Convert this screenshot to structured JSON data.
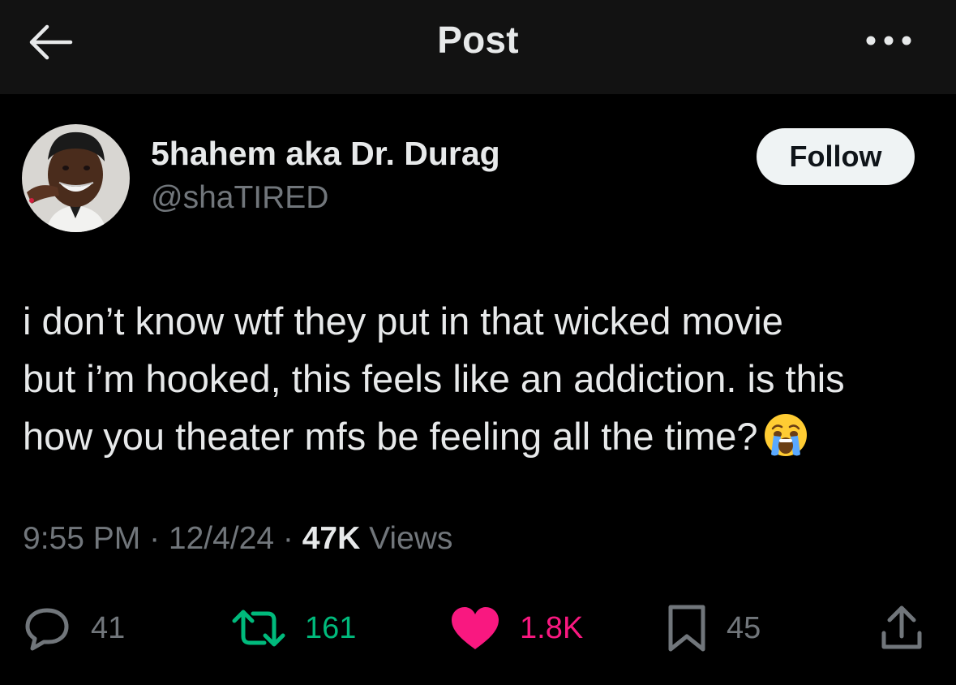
{
  "header": {
    "title": "Post"
  },
  "author": {
    "display_name": "5hahem aka Dr. Durag",
    "handle": "@shaTIRED",
    "follow_label": "Follow"
  },
  "post": {
    "lines": [
      "i don’t know wtf they put in that wicked movie",
      "but i’m hooked, this feels like an addiction. is this",
      "how you theater mfs be feeling all the time?"
    ],
    "emoji": "crying-face-emoji"
  },
  "meta": {
    "time": "9:55 PM",
    "sep1": " · ",
    "date": "12/4/24",
    "sep2": " · ",
    "views_count": "47K",
    "views_label": " Views"
  },
  "actions": {
    "replies": "41",
    "reposts": "161",
    "likes": "1.8K",
    "bookmarks": "45"
  },
  "colors": {
    "background": "#000000",
    "header_bg": "#121212",
    "text_primary": "#e7e9ea",
    "text_secondary": "#71767b",
    "repost_green": "#00ba7c",
    "like_pink": "#f91880",
    "follow_button_bg": "#eff3f4"
  },
  "icons": [
    "back-arrow-icon",
    "more-icon",
    "reply-icon",
    "repost-icon",
    "like-heart-icon",
    "bookmark-icon",
    "share-icon"
  ]
}
